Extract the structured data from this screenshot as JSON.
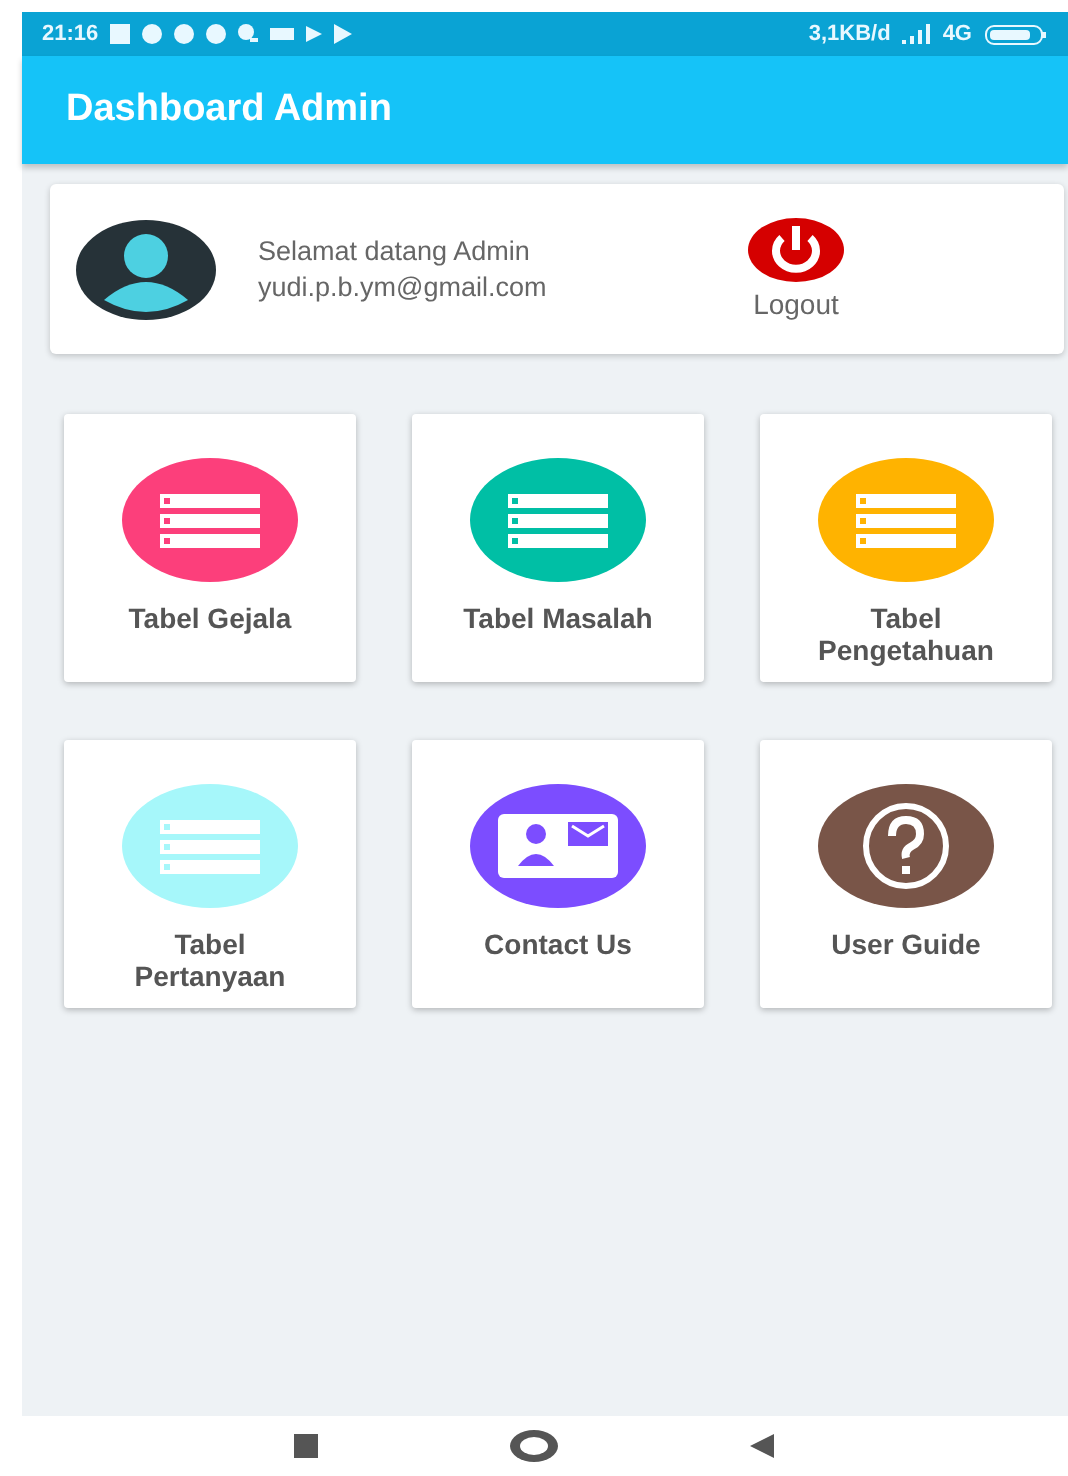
{
  "status_bar": {
    "time": "21:16",
    "speed": "3,1KB/d",
    "network": "4G"
  },
  "app_bar": {
    "title": "Dashboard Admin"
  },
  "profile": {
    "greeting": "Selamat datang Admin",
    "email": "yudi.p.b.ym@gmail.com",
    "logout_label": "Logout"
  },
  "tiles": [
    {
      "label": "Tabel Gejala",
      "kind": "list",
      "color": "#fc3f7b"
    },
    {
      "label": "Tabel Masalah",
      "kind": "list",
      "color": "#00bfa5"
    },
    {
      "label": "Tabel Pengetahuan",
      "kind": "list",
      "color": "#ffb300"
    },
    {
      "label": "Tabel Pertanyaan",
      "kind": "list",
      "color": "#a6f7fa"
    },
    {
      "label": "Contact Us",
      "kind": "contact",
      "color": "#7c4dff"
    },
    {
      "label": "User Guide",
      "kind": "help",
      "color": "#795548"
    }
  ]
}
